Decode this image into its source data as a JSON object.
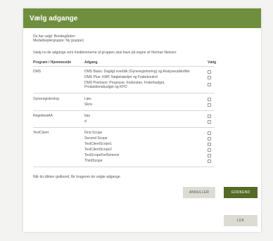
{
  "dialog": {
    "title": "Vælg adgange",
    "selected_farm": "Du har valgt: Bondegården",
    "employee_group": "Medarbejdergruppe: Ny gruppe1",
    "instruction": "Vælg nu de adgange som medlemmerne af gruppen skal have på vegne af Herman Nielsen:"
  },
  "table": {
    "headers": {
      "program": "Program / Hjemmeside",
      "access": "Adgang",
      "choose": "Vælg"
    },
    "groups": [
      {
        "program": "DMS",
        "items": [
          "DMS Basis: Dagligt overblik (Gyneregistrering) og Analyseudskrifter",
          "DMS Plus: KMP, Nøgletabeljet og Foderkontrol",
          "DMS Premium: Prognose, Foderstan, Foderbudget,",
          "Produktionsbudget og KPO"
        ]
      },
      {
        "program": "Gyneregistrering",
        "items": [
          "Læs",
          "Skriv"
        ]
      },
      {
        "program": "RegeltestAA",
        "items": [
          "bas",
          "d"
        ]
      },
      {
        "program": "TestClient",
        "items": [
          "First Scope",
          "Second Scope",
          "TestClientScope1",
          "TestClientScope2",
          "TestScopeForRemove",
          "ThirdScope"
        ]
      }
    ]
  },
  "footer_note": "Når du klikker godkend, får brugeren de valgte adgange.",
  "buttons": {
    "cancel": "ANNULLER",
    "approve": "GODKEND",
    "close": "LUK"
  },
  "colors": {
    "header": "#6f8f3f",
    "approve_button": "#556b25",
    "neutral_button": "#dcdcd4"
  }
}
